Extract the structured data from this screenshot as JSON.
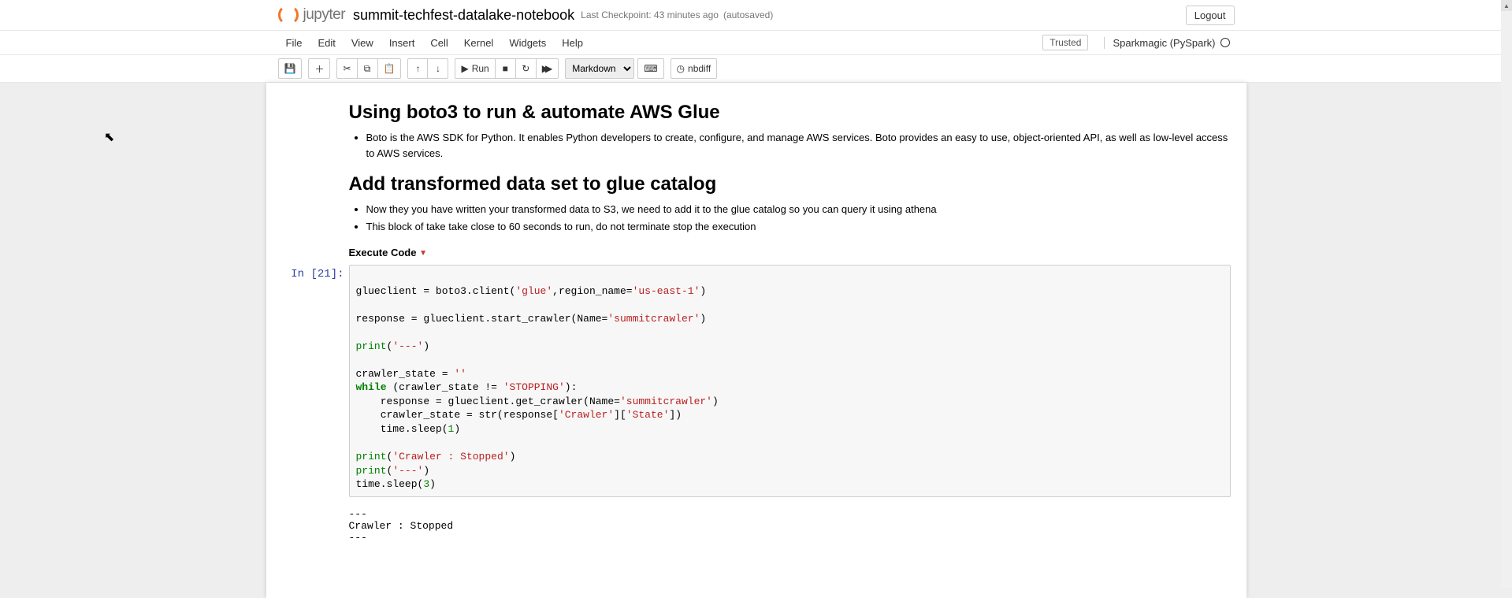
{
  "brand": "jupyter",
  "notebook_name": "summit-techfest-datalake-notebook",
  "checkpoint": "Last Checkpoint: 43 minutes ago",
  "autosave": "(autosaved)",
  "logout": "Logout",
  "menu": {
    "file": "File",
    "edit": "Edit",
    "view": "View",
    "insert": "Insert",
    "cell": "Cell",
    "kernel": "Kernel",
    "widgets": "Widgets",
    "help": "Help"
  },
  "trusted": "Trusted",
  "kernel_name": "Sparkmagic (PySpark)",
  "toolbar": {
    "run": "Run",
    "nbdiff": "nbdiff",
    "cell_type": "Markdown"
  },
  "md1": {
    "h_a": "Using boto3 to run & automate AWS Glue",
    "li_a1": "Boto is the AWS SDK for Python. It enables Python developers to create, configure, and manage AWS services. Boto provides an easy to use, object-oriented API, as well as low-level access to AWS services.",
    "h_b": "Add transformed data set to glue catalog",
    "li_b1": "Now they you have written your transformed data to S3, we need to add it to the glue catalog so you can query it using athena",
    "li_b2": "This block of take take close to 60 seconds to run, do not terminate stop the execution",
    "execute": "Execute Code",
    "tri": "▼"
  },
  "code": {
    "prompt": "In [21]:",
    "l01a": "glueclient = boto3.client(",
    "l01b": "'glue'",
    "l01c": ",region_name=",
    "l01d": "'us-east-1'",
    "l01e": ")",
    "l02a": "response = glueclient.start_crawler(Name=",
    "l02b": "'summitcrawler'",
    "l02c": ")",
    "l03a": "print",
    "l03b": "(",
    "l03c": "'---'",
    "l03d": ")",
    "l04a": "crawler_state = ",
    "l04b": "''",
    "l05a": "while",
    "l05b": " (crawler_state != ",
    "l05c": "'STOPPING'",
    "l05d": "):",
    "l06a": "    response = glueclient.get_crawler(Name=",
    "l06b": "'summitcrawler'",
    "l06c": ")",
    "l07a": "    crawler_state = str(response[",
    "l07b": "'Crawler'",
    "l07c": "][",
    "l07d": "'State'",
    "l07e": "])",
    "l08a": "    time.sleep(",
    "l08b": "1",
    "l08c": ")",
    "l09a": "print",
    "l09b": "(",
    "l09c": "'Crawler : Stopped'",
    "l09d": ")",
    "l10a": "print",
    "l10b": "(",
    "l10c": "'---'",
    "l10d": ")",
    "l11a": "time.sleep(",
    "l11b": "3",
    "l11c": ")"
  },
  "output_text": "---\nCrawler : Stopped\n---"
}
